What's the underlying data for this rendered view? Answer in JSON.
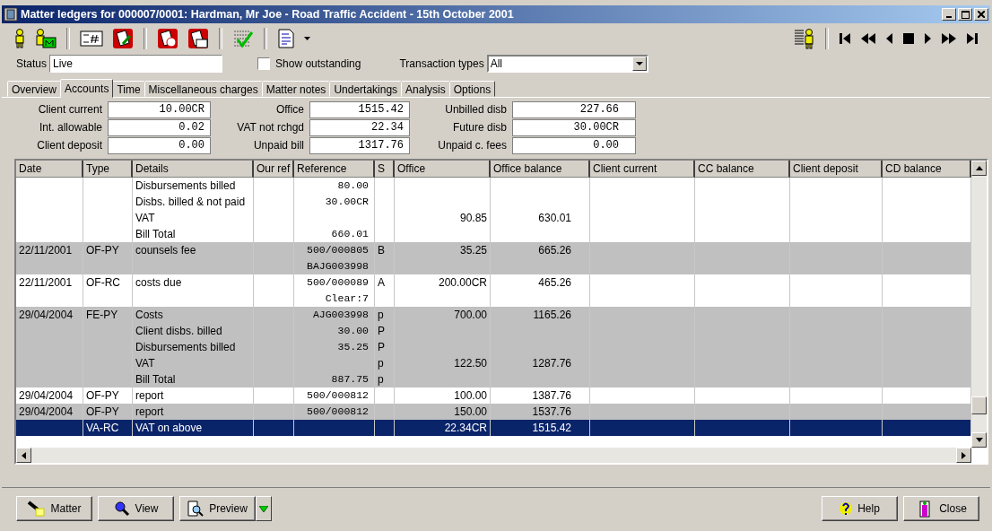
{
  "window": {
    "title": "Matter ledgers for 000007/0001: Hardman, Mr Joe - Road Traffic Accident - 15th October 2001"
  },
  "filters": {
    "status_label": "Status",
    "status_value": "Live",
    "show_outstanding": {
      "label": "Show outstanding",
      "checked": false
    },
    "transaction_types_label": "Transaction types",
    "transaction_types_value": "All"
  },
  "tabs": [
    {
      "label": "Overview",
      "selected": false
    },
    {
      "label": "Accounts",
      "selected": true
    },
    {
      "label": "Time",
      "selected": false
    },
    {
      "label": "Miscellaneous charges",
      "selected": false
    },
    {
      "label": "Matter notes",
      "selected": false
    },
    {
      "label": "Undertakings",
      "selected": false
    },
    {
      "label": "Analysis",
      "selected": false
    },
    {
      "label": "Options",
      "selected": false
    }
  ],
  "summary": [
    [
      {
        "label": "Client current",
        "value": "10.00CR"
      },
      {
        "label": "Int. allowable",
        "value": "0.02"
      },
      {
        "label": "Client deposit",
        "value": "0.00"
      }
    ],
    [
      {
        "label": "Office",
        "value": "1515.42"
      },
      {
        "label": "VAT not rchgd",
        "value": "22.34"
      },
      {
        "label": "Unpaid bill",
        "value": "1317.76"
      }
    ],
    [
      {
        "label": "Unbilled disb",
        "value": "227.66"
      },
      {
        "label": "Future disb",
        "value": "30.00CR"
      },
      {
        "label": "Unpaid c. fees",
        "value": "0.00"
      }
    ]
  ],
  "table": {
    "columns": [
      "Date",
      "Type",
      "Details",
      "Our ref",
      "Reference",
      "S",
      "Office",
      "Office balance",
      "Client current",
      "CC balance",
      "Client deposit",
      "CD balance"
    ],
    "rows": [
      {
        "selected": false,
        "lines": [
          {
            "details": "Disbursements billed",
            "reference": "80.00"
          },
          {
            "details": "Disbs. billed & not paid",
            "reference": "30.00CR"
          },
          {
            "details": "VAT",
            "office": "90.85",
            "office_balance": "630.01"
          },
          {
            "details": "Bill Total",
            "reference": "660.01"
          }
        ]
      },
      {
        "selected": false,
        "lines": [
          {
            "date": "22/11/2001",
            "type": "OF-PY",
            "details": "counsels fee",
            "reference": "500/000805",
            "s": "B",
            "office": "35.25",
            "office_balance": "665.26"
          },
          {
            "reference": "BAJG003998"
          }
        ]
      },
      {
        "selected": false,
        "lines": [
          {
            "date": "22/11/2001",
            "type": "OF-RC",
            "details": "costs due",
            "reference": "500/000089",
            "s": "A",
            "office": "200.00CR",
            "office_balance": "465.26"
          },
          {
            "reference": "Clear:7"
          }
        ]
      },
      {
        "selected": false,
        "lines": [
          {
            "date": "29/04/2004",
            "type": "FE-PY",
            "details": "Costs",
            "reference": "AJG003998",
            "s": "p",
            "office": "700.00",
            "office_balance": "1165.26"
          },
          {
            "details": "Client disbs. billed",
            "reference": "30.00",
            "s": "P"
          },
          {
            "details": "Disbursements billed",
            "reference": "35.25",
            "s": "P"
          },
          {
            "details": "VAT",
            "s": "p",
            "office": "122.50",
            "office_balance": "1287.76"
          },
          {
            "details": "Bill Total",
            "reference": "887.75",
            "s": "p"
          }
        ]
      },
      {
        "selected": false,
        "lines": [
          {
            "date": "29/04/2004",
            "type": "OF-PY",
            "details": "report",
            "reference": "500/000812",
            "office": "100.00",
            "office_balance": "1387.76"
          }
        ]
      },
      {
        "selected": false,
        "lines": [
          {
            "date": "29/04/2004",
            "type": "OF-PY",
            "details": "report",
            "reference": "500/000812",
            "office": "150.00",
            "office_balance": "1537.76"
          }
        ]
      },
      {
        "selected": true,
        "lines": [
          {
            "type": "VA-RC",
            "details": "VAT on above",
            "office": "22.34CR",
            "office_balance": "1515.42"
          }
        ]
      }
    ]
  },
  "buttons": [
    {
      "kind": "matter",
      "label": "Matter"
    },
    {
      "kind": "view",
      "label": "View"
    },
    {
      "kind": "preview",
      "label": "Preview"
    },
    {
      "kind": "help",
      "label": "Help"
    },
    {
      "kind": "close",
      "label": "Close"
    }
  ]
}
